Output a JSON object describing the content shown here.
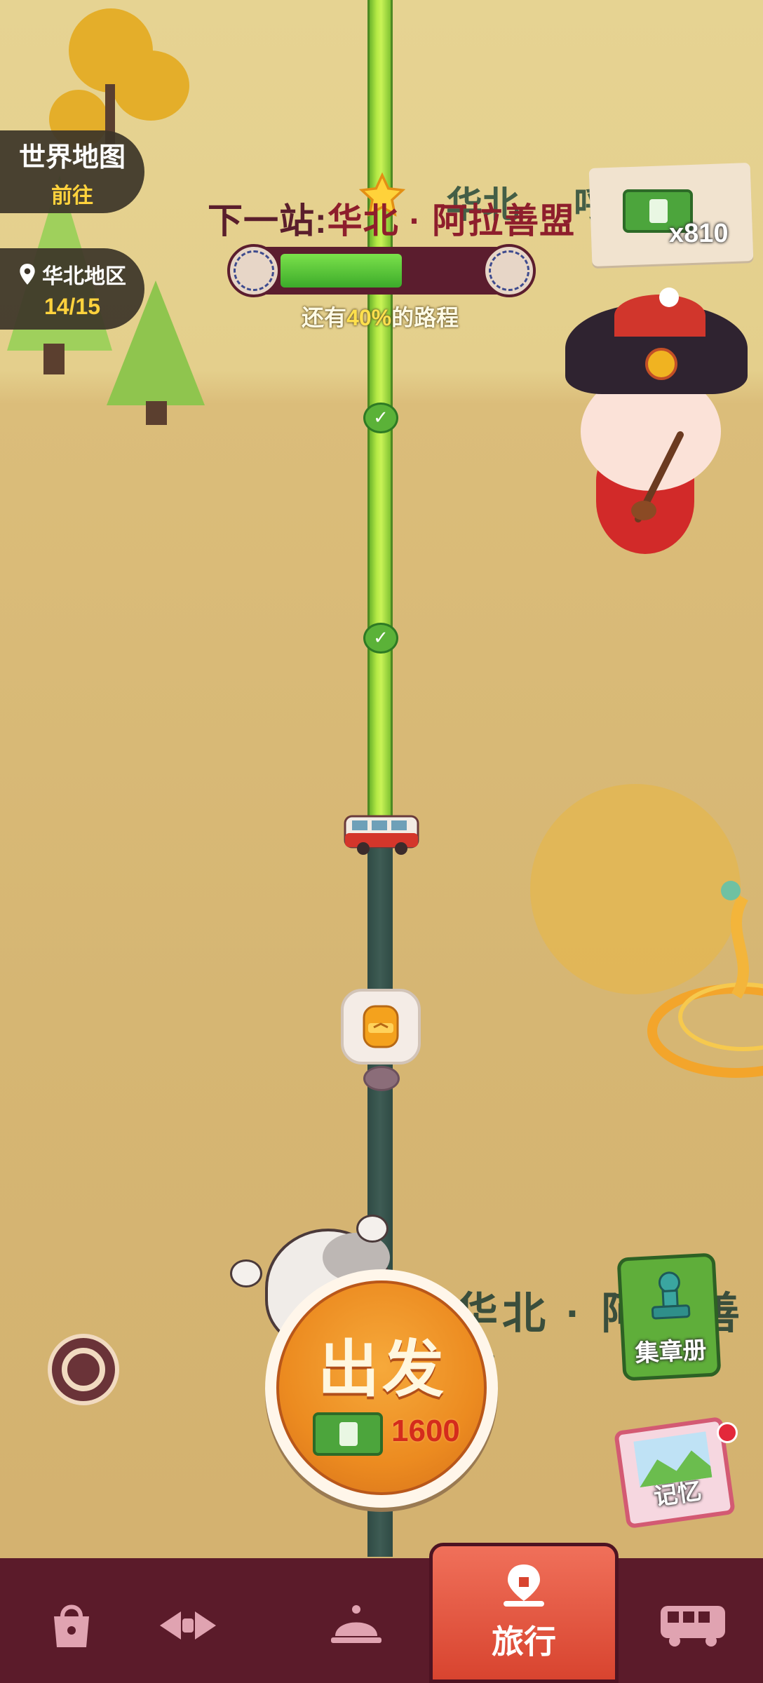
{
  "world_map": {
    "title": "世界地图",
    "action": "前往"
  },
  "region": {
    "name": "华北地区",
    "progress": "14/15"
  },
  "next_stop": {
    "prefix": "下一站:",
    "destination": "华北 · 阿拉善盟"
  },
  "background_text": {
    "top": "华北",
    "top_right": "呼",
    "bottom": "华北 · 阿拉善盟"
  },
  "route_progress": {
    "fraction": 0.6,
    "remaining_prefix": "还有",
    "remaining_pct": "40%",
    "remaining_suffix": "的路程"
  },
  "cash": {
    "count": "x810"
  },
  "go_button": {
    "label": "出发",
    "cost": "1600"
  },
  "side_buttons": {
    "stamp_book": "集章册",
    "memory": "记忆"
  },
  "tabs": [
    {
      "name": "shop",
      "icon": "bag-icon",
      "label": ""
    },
    {
      "name": "bows",
      "icon": "bow-icon",
      "label": ""
    },
    {
      "name": "service",
      "icon": "bell-icon",
      "label": ""
    },
    {
      "name": "travel",
      "icon": "map-pin-icon",
      "label": "旅行",
      "active": true
    },
    {
      "name": "bus",
      "icon": "bus-icon",
      "label": ""
    }
  ],
  "colors": {
    "accent_green": "#5bb238",
    "tab_bg": "#5b1b2a",
    "go_orange": "#ec8b20",
    "active_tab": "#d8442f"
  }
}
